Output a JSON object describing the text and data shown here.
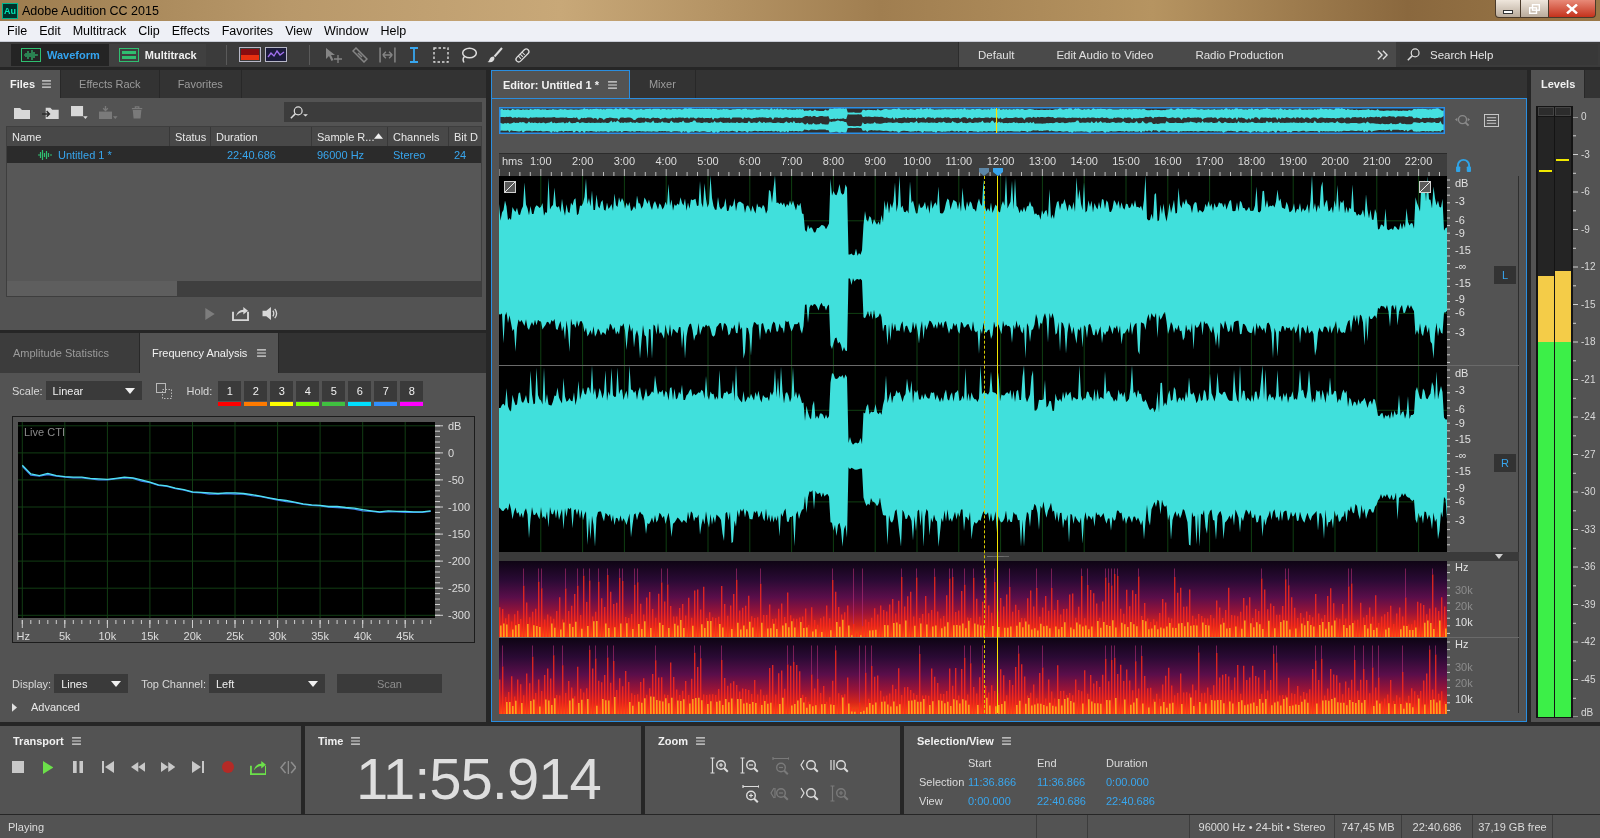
{
  "window": {
    "app_icon": "Au",
    "title": "Adobe Audition CC 2015"
  },
  "menu": [
    "File",
    "Edit",
    "Multitrack",
    "Clip",
    "Effects",
    "Favorites",
    "View",
    "Window",
    "Help"
  ],
  "toolbar": {
    "modes": [
      {
        "kind": "waveform",
        "label": "Waveform",
        "selected": true
      },
      {
        "kind": "multitrack",
        "label": "Multitrack",
        "selected": false
      }
    ],
    "tools": [
      {
        "kind": "move",
        "selected": false,
        "disabled": true
      },
      {
        "kind": "razor",
        "selected": false,
        "disabled": true
      },
      {
        "kind": "slip",
        "selected": false,
        "disabled": true
      },
      {
        "kind": "ibeam",
        "selected": true,
        "disabled": false
      },
      {
        "kind": "marquee",
        "selected": false,
        "disabled": false
      },
      {
        "kind": "lasso",
        "selected": false,
        "disabled": false
      },
      {
        "kind": "brush",
        "selected": false,
        "disabled": false
      },
      {
        "kind": "heal",
        "selected": false,
        "disabled": false
      }
    ],
    "workspaces": [
      "Default",
      "Edit Audio to Video",
      "Radio Production"
    ],
    "search": {
      "placeholder": "Search Help"
    }
  },
  "files_panel": {
    "tabs": [
      {
        "label": "Files",
        "selected": true
      },
      {
        "label": "Effects Rack",
        "selected": false
      },
      {
        "label": "Favorites",
        "selected": false
      }
    ],
    "actions": [
      {
        "kind": "open",
        "disabled": false
      },
      {
        "kind": "import",
        "disabled": false
      },
      {
        "kind": "new",
        "disabled": false
      },
      {
        "kind": "insert",
        "disabled": true
      },
      {
        "kind": "delete",
        "disabled": true
      }
    ],
    "columns": [
      {
        "label": "Name",
        "sorted": false
      },
      {
        "label": "Status",
        "sorted": false
      },
      {
        "label": "Duration",
        "sorted": false
      },
      {
        "label": "Sample R...",
        "sorted": true
      },
      {
        "label": "Channels",
        "sorted": false
      },
      {
        "label": "Bit D",
        "sorted": false
      }
    ],
    "rows": [
      {
        "name": "Untitled 1 *",
        "duration": "22:40.686",
        "sample_rate": "96000 Hz",
        "channels": "Stereo",
        "bit_depth": "24",
        "selected": true
      }
    ]
  },
  "analysis_panel": {
    "tabs": [
      {
        "label": "Amplitude Statistics",
        "selected": false
      },
      {
        "label": "Frequency Analysis",
        "selected": true
      }
    ],
    "scale": {
      "label": "Scale:",
      "value": "Linear"
    },
    "hold": {
      "label": "Hold:",
      "buttons": [
        {
          "label": "1",
          "color": "#ff0000"
        },
        {
          "label": "2",
          "color": "#ff7a00"
        },
        {
          "label": "3",
          "color": "#ffff00"
        },
        {
          "label": "4",
          "color": "#80ff00"
        },
        {
          "label": "5",
          "color": "#40c040"
        },
        {
          "label": "6",
          "color": "#00e0ff"
        },
        {
          "label": "7",
          "color": "#3090ff"
        },
        {
          "label": "8",
          "color": "#ff00ff"
        }
      ]
    },
    "chart_data": {
      "type": "line",
      "title": "Live CTI",
      "xlabel": "Hz",
      "ylabel": "dB",
      "grid": true,
      "x": [
        0,
        1000,
        2000,
        3000,
        4000,
        5000,
        6000,
        7000,
        8000,
        9000,
        10000,
        11000,
        12000,
        13000,
        14000,
        15000,
        16000,
        17000,
        18000,
        19000,
        20000,
        21000,
        22000,
        23000,
        24000,
        25000,
        26000,
        27000,
        28000,
        29000,
        30000,
        31000,
        32000,
        33000,
        34000,
        35000,
        36000,
        37000,
        38000,
        39000,
        40000,
        41000,
        42000,
        43000,
        44000,
        45000,
        46000,
        47000,
        48000
      ],
      "series": [
        {
          "color": "#3b7be8",
          "values": [
            -25,
            -41,
            -43,
            -40,
            -43,
            -45,
            -46,
            -46,
            -48,
            -50,
            -50,
            -48,
            -46,
            -47,
            -52,
            -55,
            -60,
            -62,
            -66,
            -69,
            -73,
            -74,
            -76,
            -76,
            -75,
            -76,
            -76,
            -79,
            -81,
            -84,
            -87,
            -90,
            -92,
            -95,
            -97,
            -98,
            -100,
            -101,
            -102,
            -104,
            -107,
            -108,
            -110,
            -109,
            -109,
            -110,
            -110,
            -110,
            -108
          ]
        },
        {
          "color": "#52e4f2",
          "values": [
            -23,
            -39,
            -42,
            -38,
            -42,
            -44,
            -45,
            -45,
            -47,
            -48,
            -49,
            -47,
            -45,
            -46,
            -50,
            -54,
            -59,
            -61,
            -65,
            -68,
            -72,
            -73,
            -74,
            -75,
            -74,
            -74,
            -75,
            -77,
            -80,
            -83,
            -86,
            -88,
            -91,
            -94,
            -96,
            -97,
            -99,
            -99,
            -101,
            -102,
            -105,
            -107,
            -109,
            -107,
            -108,
            -108,
            -109,
            -109,
            -107
          ]
        }
      ],
      "xlim": [
        -500,
        48500
      ],
      "ylim": [
        -305,
        57
      ],
      "xticks": [
        {
          "value": 5000,
          "label": "5k"
        },
        {
          "value": 10000,
          "label": "10k"
        },
        {
          "value": 15000,
          "label": "15k"
        },
        {
          "value": 20000,
          "label": "20k"
        },
        {
          "value": 25000,
          "label": "25k"
        },
        {
          "value": 30000,
          "label": "30k"
        },
        {
          "value": 35000,
          "label": "35k"
        },
        {
          "value": 40000,
          "label": "40k"
        },
        {
          "value": 45000,
          "label": "45k"
        }
      ],
      "yticks": [
        0,
        -50,
        -100,
        -150,
        -200,
        -250,
        -300
      ]
    },
    "display": {
      "label": "Display:",
      "value": "Lines"
    },
    "top_channel": {
      "label": "Top Channel:",
      "value": "Left"
    },
    "scan": {
      "label": "Scan",
      "disabled": true
    },
    "advanced": {
      "label": "Advanced",
      "expanded": false
    }
  },
  "editor": {
    "tabs": [
      {
        "label": "Editor: Untitled 1 *",
        "selected": true
      },
      {
        "label": "Mixer",
        "selected": false
      }
    ],
    "ruler": {
      "unit": "hms",
      "labels": [
        "1:00",
        "2:00",
        "3:00",
        "4:00",
        "5:00",
        "6:00",
        "7:00",
        "8:00",
        "9:00",
        "10:00",
        "11:00",
        "12:00",
        "13:00",
        "14:00",
        "15:00",
        "16:00",
        "17:00",
        "18:00",
        "19:00",
        "20:00",
        "21:00",
        "22:00"
      ]
    },
    "insertion_point": {
      "level": 0.512
    },
    "playhead": {
      "level": 0.526
    },
    "channels": [
      {
        "badge": "L",
        "scale": [
          "dB",
          "-3",
          "-6",
          "-9",
          "-15",
          "-∞",
          "-15",
          "-9",
          "-6",
          "-3"
        ]
      },
      {
        "badge": "R",
        "scale": [
          "dB",
          "-3",
          "-6",
          "-9",
          "-15",
          "-∞",
          "-15",
          "-9",
          "-6",
          "-3"
        ]
      }
    ],
    "spectral_channels": [
      {
        "scale": [
          "Hz",
          "30k",
          "20k",
          "10k"
        ]
      },
      {
        "scale": [
          "Hz",
          "30k",
          "20k",
          "10k"
        ]
      }
    ]
  },
  "levels": {
    "tabs": [
      {
        "label": "Levels",
        "selected": true
      }
    ],
    "scale": [
      "0",
      "-3",
      "-6",
      "-9",
      "-12",
      "-15",
      "-18",
      "-21",
      "-24",
      "-27",
      "-30",
      "-33",
      "-36",
      "-39",
      "-42",
      "-45",
      "dB"
    ],
    "meters": [
      {
        "level": 0.735,
        "peak": {
          "level": 0.908
        }
      },
      {
        "level": 0.744,
        "peak": {
          "level": 0.927
        }
      }
    ]
  },
  "transport": {
    "title": "Transport",
    "buttons": [
      {
        "kind": "stop",
        "on": false,
        "disabled": false
      },
      {
        "kind": "play",
        "on": true,
        "disabled": false
      },
      {
        "kind": "pause",
        "on": false,
        "disabled": false
      },
      {
        "kind": "start",
        "on": false,
        "disabled": false
      },
      {
        "kind": "rewind",
        "on": false,
        "disabled": false
      },
      {
        "kind": "forward",
        "on": false,
        "disabled": false
      },
      {
        "kind": "end",
        "on": false,
        "disabled": false
      },
      {
        "kind": "record",
        "on": false,
        "disabled": false
      },
      {
        "kind": "loop",
        "on": true,
        "disabled": false
      },
      {
        "kind": "skip",
        "on": false,
        "disabled": true
      }
    ]
  },
  "time": {
    "title": "Time",
    "value": "11:55.914"
  },
  "zoom": {
    "title": "Zoom",
    "rows": [
      [
        {
          "kind": "ampin",
          "disabled": false
        },
        {
          "kind": "ampout",
          "disabled": false
        },
        {
          "kind": "fullout",
          "disabled": true
        },
        {
          "kind": "startin",
          "disabled": false
        },
        {
          "kind": "bothin",
          "disabled": false
        }
      ],
      [
        {
          "kind": "timein",
          "disabled": false
        },
        {
          "kind": "timeout",
          "disabled": true
        },
        {
          "kind": "endin",
          "disabled": false
        },
        {
          "kind": "ampreset",
          "disabled": true
        }
      ]
    ]
  },
  "selection_view": {
    "title": "Selection/View",
    "columns": [
      "Start",
      "End",
      "Duration"
    ],
    "rows": [
      {
        "label": "Selection",
        "values": [
          "11:36.866",
          "11:36.866",
          "0:00.000"
        ]
      },
      {
        "label": "View",
        "values": [
          "0:00.000",
          "22:40.686",
          "22:40.686"
        ]
      }
    ]
  },
  "status_bar": {
    "state": "Playing",
    "segments": [
      "96000 Hz • 24-bit • Stereo",
      "747,45 MB",
      "22:40.686",
      "37,19 GB free"
    ]
  }
}
